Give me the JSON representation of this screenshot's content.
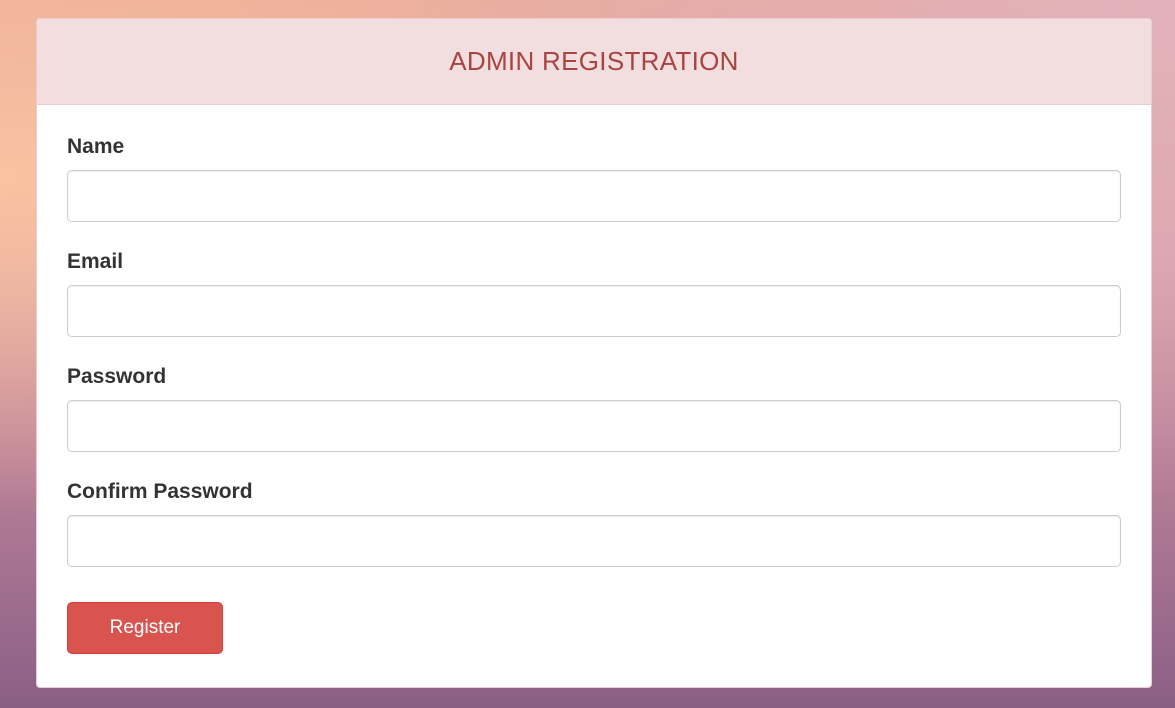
{
  "panel": {
    "title": "ADMIN REGISTRATION"
  },
  "form": {
    "fields": [
      {
        "label": "Name",
        "value": "",
        "placeholder": ""
      },
      {
        "label": "Email",
        "value": "",
        "placeholder": ""
      },
      {
        "label": "Password",
        "value": "",
        "placeholder": ""
      },
      {
        "label": "Confirm Password",
        "value": "",
        "placeholder": ""
      }
    ],
    "submit_label": "Register"
  },
  "colors": {
    "heading_bg": "#f2dede",
    "heading_text": "#a94442",
    "button_bg": "#d9534f"
  }
}
